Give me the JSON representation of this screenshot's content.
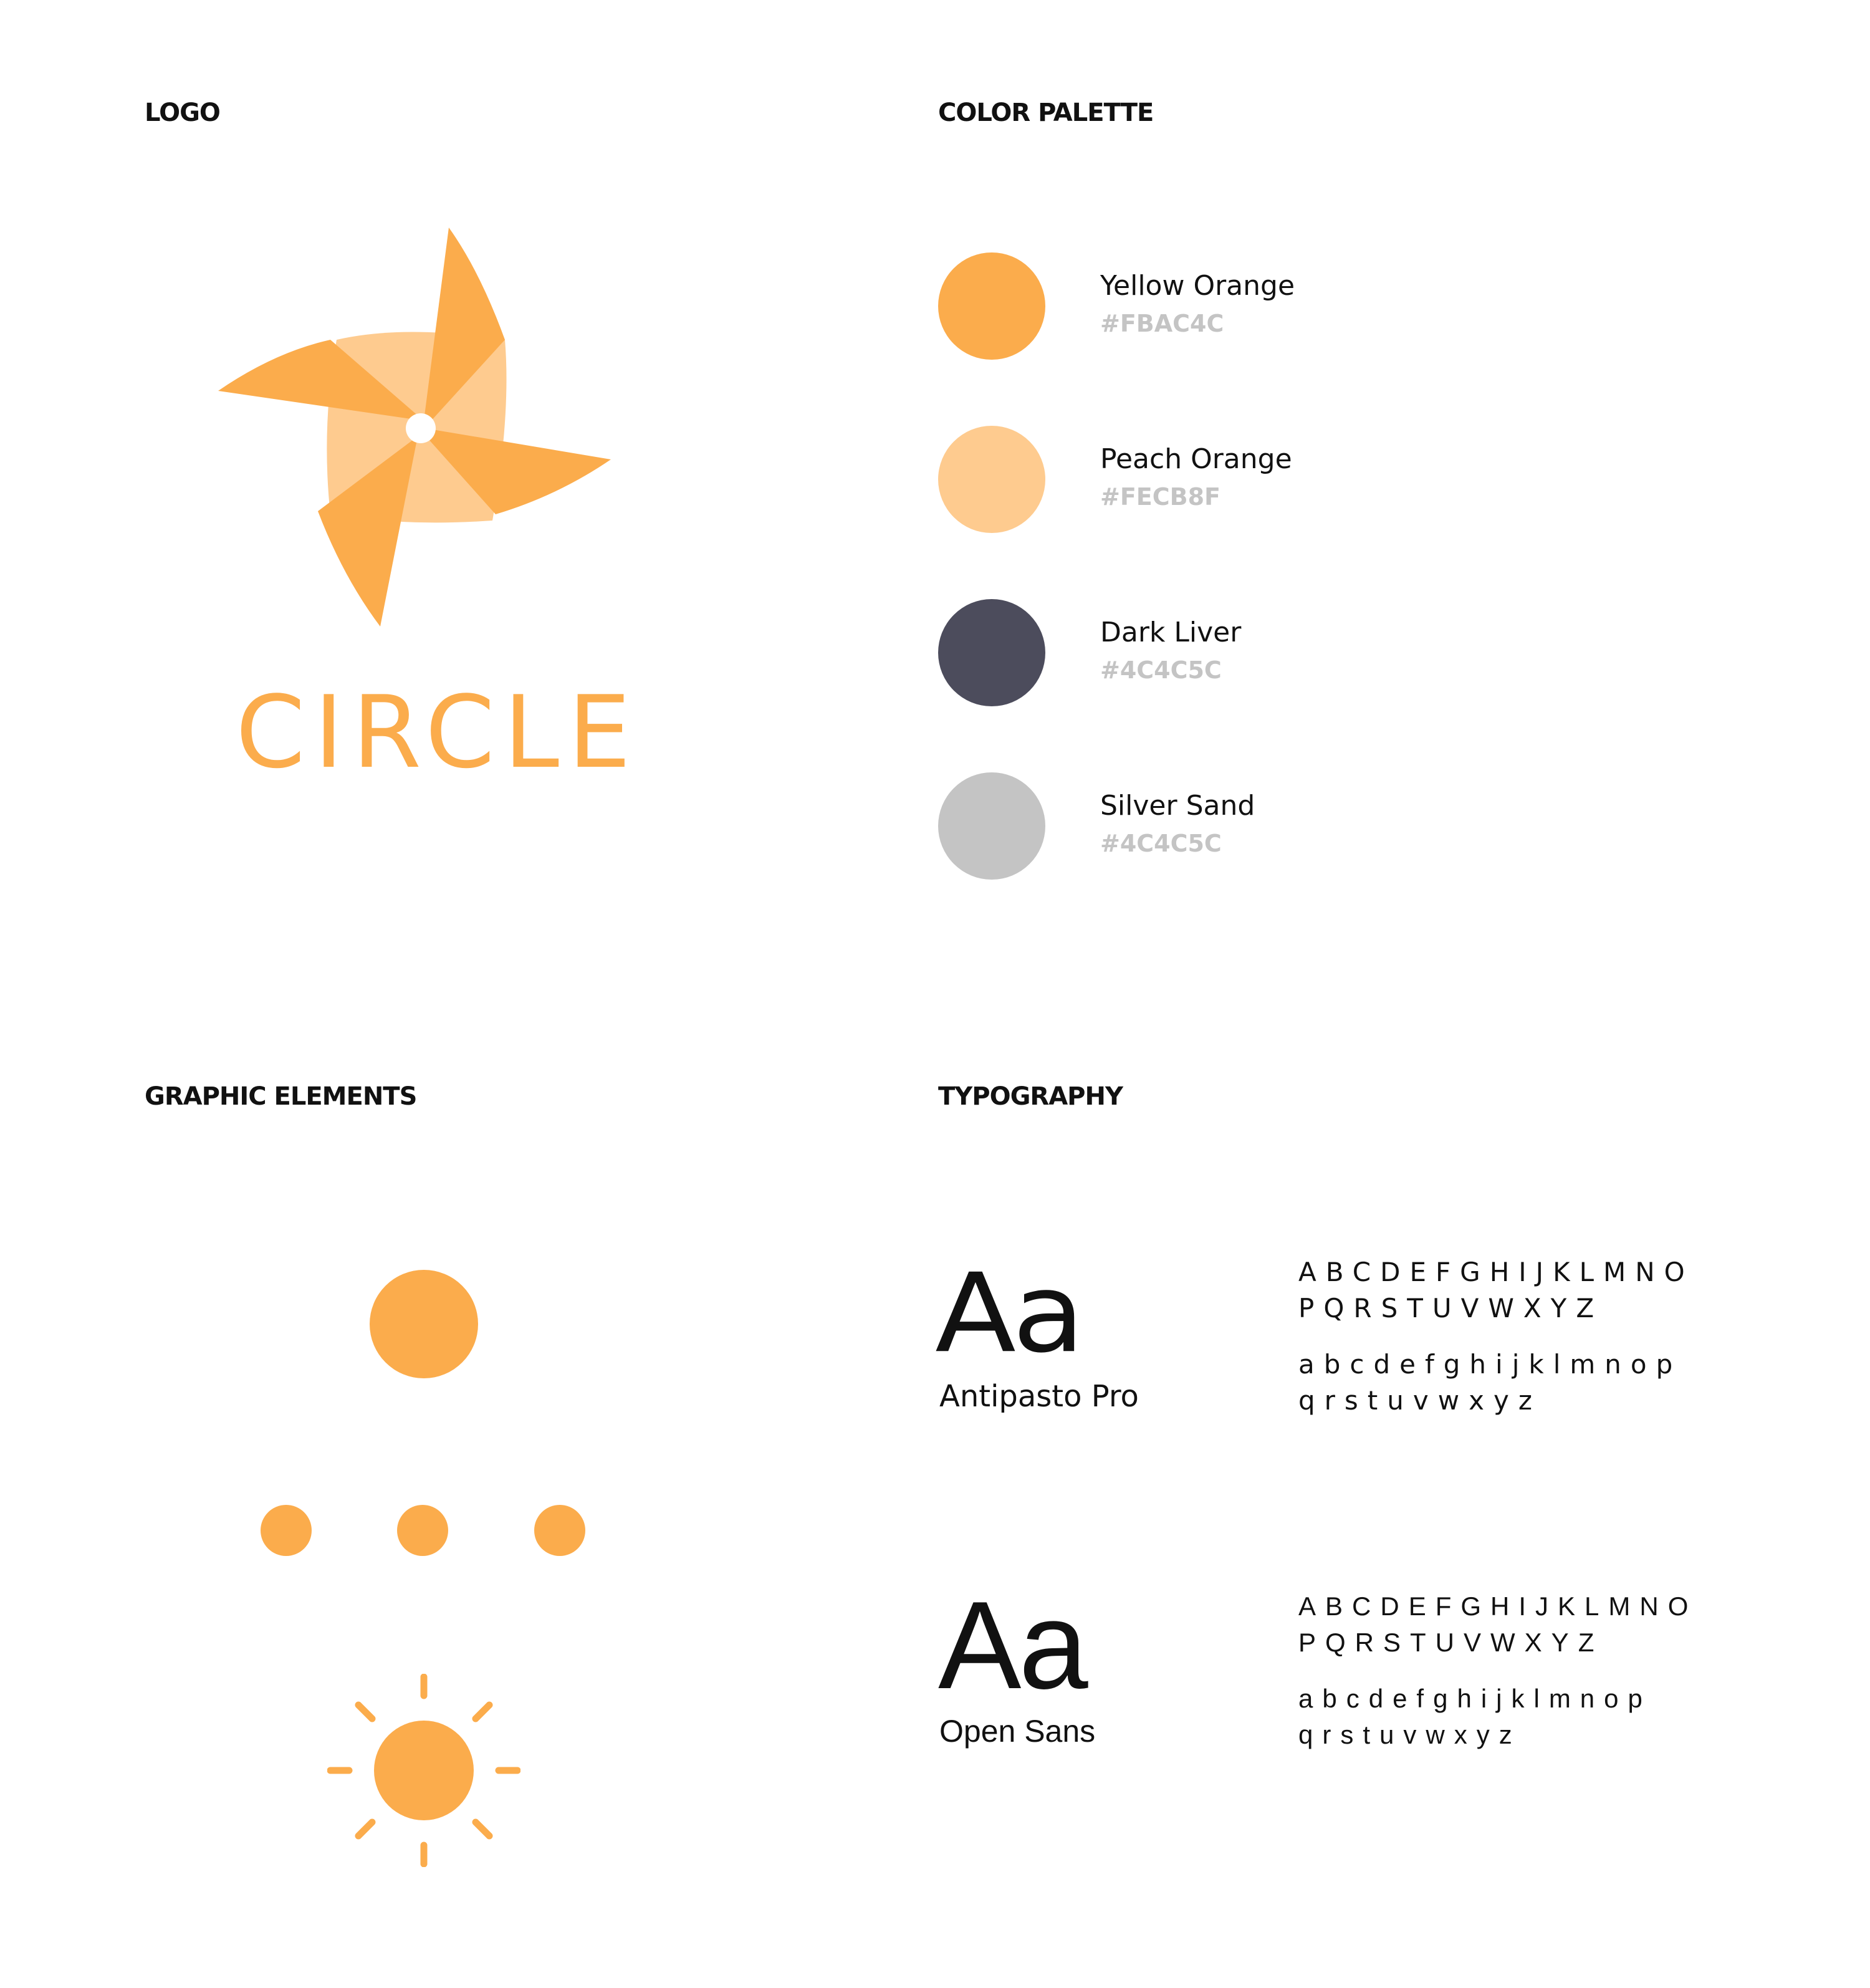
{
  "sections": {
    "logo": "LOGO",
    "color_palette": "COLOR PALETTE",
    "graphic_elements": "GRAPHIC ELEMENTS",
    "typography": "TYPOGRAPHY"
  },
  "logo": {
    "icon": "pinwheel-icon",
    "wordmark": "CIRCLE",
    "colors": {
      "primary": "#FBAC4C",
      "secondary": "#FECB8F",
      "center": "#FFFFFF"
    }
  },
  "palette": [
    {
      "name": "Yellow Orange",
      "hex": "#FBAC4C",
      "color": "#FBAC4C"
    },
    {
      "name": "Peach Orange",
      "hex": "#FECB8F",
      "color": "#FECB8F"
    },
    {
      "name": "Dark Liver",
      "hex": "#4C4C5C",
      "color": "#4C4C5C"
    },
    {
      "name": "Silver Sand",
      "hex": "#4C4C5C",
      "color": "#C4C4C4"
    }
  ],
  "graphic_elements": {
    "items": [
      "large-circle-icon",
      "three-dots-icon",
      "sun-icon"
    ],
    "color": "#FBAC4C"
  },
  "typography": {
    "fonts": [
      {
        "sample": "Aa",
        "name": "Antipasto Pro",
        "upper_1": "ABCDEFGHIJKLMNO",
        "upper_2": "PQRSTUVWXYZ",
        "lower_1": "abcdefghijklmnop",
        "lower_2": "qrstuvwxyz"
      },
      {
        "sample": "Aa",
        "name": "Open Sans",
        "upper_1": "ABCDEFGHIJKLMNO",
        "upper_2": "PQRSTUVWXYZ",
        "lower_1": "abcdefghijklmnop",
        "lower_2": "qrstuvwxyz"
      }
    ]
  }
}
